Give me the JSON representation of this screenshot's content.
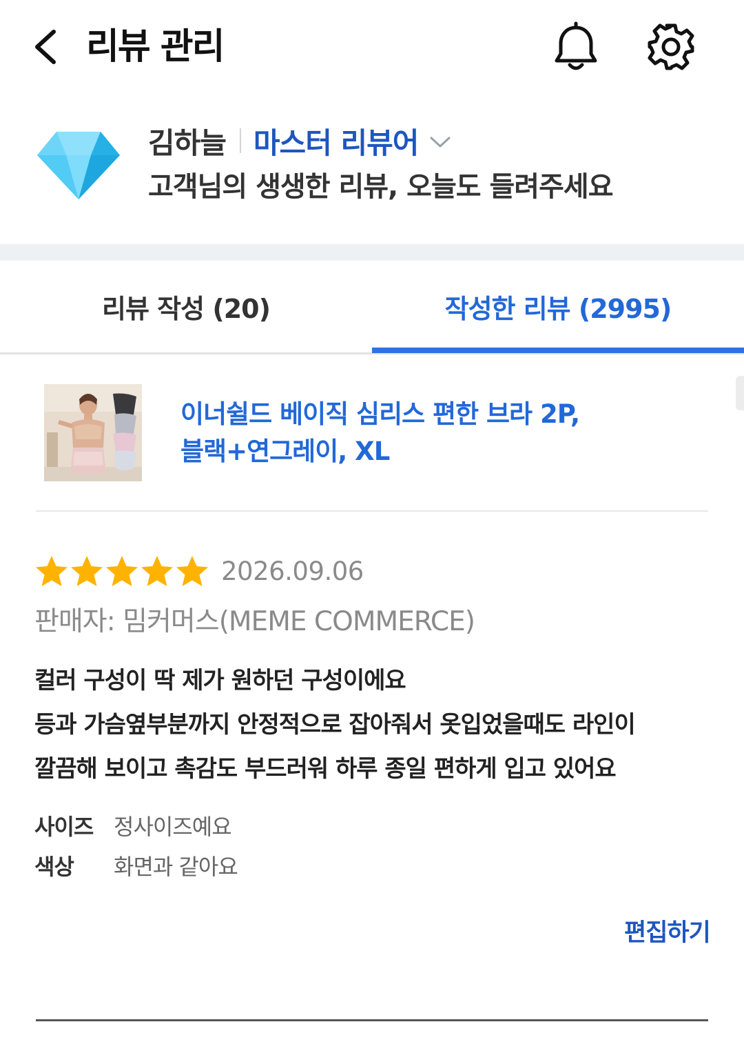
{
  "header": {
    "title": "리뷰 관리",
    "back_icon": "chevron-left-icon",
    "notification_icon": "bell-icon",
    "settings_icon": "gear-icon"
  },
  "profile": {
    "badge_icon": "diamond-icon",
    "name": "김하늘",
    "grade": "마스터 리뷰어",
    "grade_dropdown_icon": "chevron-down-icon",
    "slogan": "고객님의 생생한 리뷰, 오늘도 들려주세요"
  },
  "tabs": [
    {
      "label": "리뷰 작성 (20)",
      "active": false
    },
    {
      "label": "작성한 리뷰 (2995)",
      "active": true
    }
  ],
  "product": {
    "name_line1": "이너쉴드 베이직 심리스 편한 브라 2P,",
    "name_line2": "블랙+연그레이, XL"
  },
  "review": {
    "rating": 5,
    "rating_max": 5,
    "date": "2026.09.06",
    "seller": "판매자: 밈커머스(MEME COMMERCE)",
    "body": [
      "컬러 구성이 딱 제가 원하던 구성이에요",
      "등과 가슴옆부분까지 안정적으로 잡아줘서 옷입었을때도 라인이",
      "깔끔해 보이고 촉감도 부드러워 하루 종일 편하게 입고 있어요"
    ],
    "attributes": [
      {
        "key": "사이즈",
        "value": "정사이즈예요"
      },
      {
        "key": "색상",
        "value": "화면과 같아요"
      }
    ],
    "edit_label": "편집하기"
  },
  "colors": {
    "accent": "#2268d8",
    "grade_text": "#1e56c0",
    "star": "#ffb300",
    "tab_underline": "#2c73e5",
    "diamond": "#3cc3f2"
  }
}
